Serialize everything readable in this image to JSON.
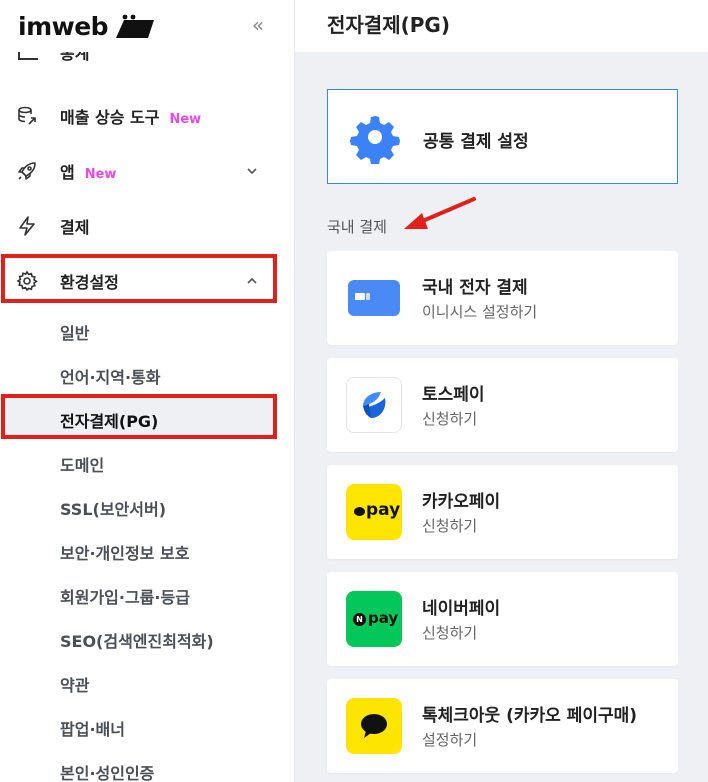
{
  "sidebar": {
    "logo_text": "imweb",
    "collapse_symbol": "«",
    "partial_item_label": "통계",
    "items": [
      {
        "label": "매출 상승 도구",
        "badge": "New",
        "icon": "sales-growth-icon"
      },
      {
        "label": "앱",
        "badge": "New",
        "icon": "rocket-icon"
      },
      {
        "label": "결제",
        "badge": "",
        "icon": "lightning-icon"
      },
      {
        "label": "환경설정",
        "badge": "",
        "icon": "gear-icon"
      }
    ],
    "sub_items": [
      {
        "label": "일반"
      },
      {
        "label": "언어·지역·통화"
      },
      {
        "label": "전자결제(PG)"
      },
      {
        "label": "도메인"
      },
      {
        "label": "SSL(보안서버)"
      },
      {
        "label": "보안·개인정보 보호"
      },
      {
        "label": "회원가입·그룹·등급"
      },
      {
        "label": "SEO(검색엔진최적화)"
      },
      {
        "label": "약관"
      },
      {
        "label": "팝업·배너"
      },
      {
        "label": "본인·성인인증"
      }
    ],
    "active_sub_index": 2
  },
  "main": {
    "page_title": "전자결제(PG)",
    "common_settings_label": "공통 결제 설정",
    "section_label": "국내 결제",
    "cards": [
      {
        "name": "국내 전자 결제",
        "sub": "이니시스 설정하기",
        "icon": "card-icon"
      },
      {
        "name": "토스페이",
        "sub": "신청하기",
        "icon": "toss-logo-icon"
      },
      {
        "name": "카카오페이",
        "sub": "신청하기",
        "icon": "kakaopay-logo-icon",
        "logo_text": "pay"
      },
      {
        "name": "네이버페이",
        "sub": "신청하기",
        "icon": "naverpay-logo-icon",
        "logo_text": "pay"
      },
      {
        "name": "톡체크아웃 (카카오 페이구매)",
        "sub": "설정하기",
        "icon": "talk-bubble-icon"
      }
    ]
  },
  "colors": {
    "accent_blue": "#3b82f6",
    "badge_new": "#e64be6",
    "highlight_red": "#e0201b",
    "kakao_yellow": "#fee500",
    "naver_green": "#03c75a"
  }
}
